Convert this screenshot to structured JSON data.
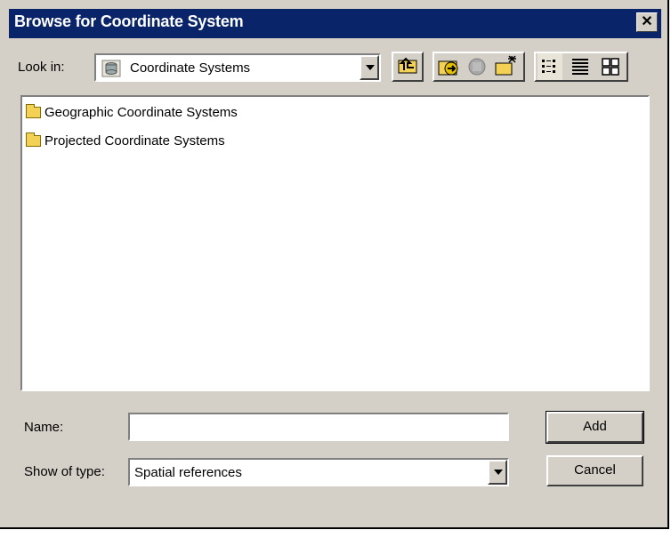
{
  "window": {
    "title": "Browse for Coordinate System"
  },
  "look_in": {
    "label": "Look in:",
    "value": "Coordinate Systems",
    "icon": "database-icon"
  },
  "toolbar": {
    "icons": [
      "up-one-level-icon",
      "connect-folder-icon",
      "disconnect-folder-icon",
      "new-folder-icon",
      "list-view-icon",
      "details-view-icon",
      "thumbnails-view-icon"
    ]
  },
  "files": [
    {
      "name": "Geographic Coordinate Systems"
    },
    {
      "name": "Projected Coordinate Systems"
    }
  ],
  "name_field": {
    "label": "Name:",
    "value": ""
  },
  "type_field": {
    "label": "Show of type:",
    "value": "Spatial references"
  },
  "buttons": {
    "add": "Add",
    "cancel": "Cancel"
  },
  "colors": {
    "titlebar": "#0a246a",
    "face": "#d4d0c8",
    "folder": "#f3d155"
  }
}
